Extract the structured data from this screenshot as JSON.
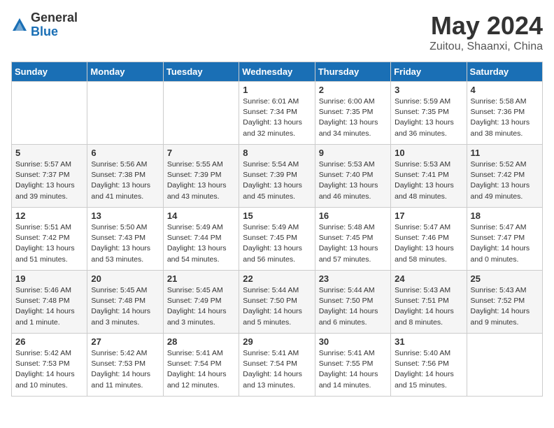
{
  "logo": {
    "general": "General",
    "blue": "Blue"
  },
  "title": "May 2024",
  "subtitle": "Zuitou, Shaanxi, China",
  "days_of_week": [
    "Sunday",
    "Monday",
    "Tuesday",
    "Wednesday",
    "Thursday",
    "Friday",
    "Saturday"
  ],
  "weeks": [
    [
      {
        "day": "",
        "info": ""
      },
      {
        "day": "",
        "info": ""
      },
      {
        "day": "",
        "info": ""
      },
      {
        "day": "1",
        "info": "Sunrise: 6:01 AM\nSunset: 7:34 PM\nDaylight: 13 hours\nand 32 minutes."
      },
      {
        "day": "2",
        "info": "Sunrise: 6:00 AM\nSunset: 7:35 PM\nDaylight: 13 hours\nand 34 minutes."
      },
      {
        "day": "3",
        "info": "Sunrise: 5:59 AM\nSunset: 7:35 PM\nDaylight: 13 hours\nand 36 minutes."
      },
      {
        "day": "4",
        "info": "Sunrise: 5:58 AM\nSunset: 7:36 PM\nDaylight: 13 hours\nand 38 minutes."
      }
    ],
    [
      {
        "day": "5",
        "info": "Sunrise: 5:57 AM\nSunset: 7:37 PM\nDaylight: 13 hours\nand 39 minutes."
      },
      {
        "day": "6",
        "info": "Sunrise: 5:56 AM\nSunset: 7:38 PM\nDaylight: 13 hours\nand 41 minutes."
      },
      {
        "day": "7",
        "info": "Sunrise: 5:55 AM\nSunset: 7:39 PM\nDaylight: 13 hours\nand 43 minutes."
      },
      {
        "day": "8",
        "info": "Sunrise: 5:54 AM\nSunset: 7:39 PM\nDaylight: 13 hours\nand 45 minutes."
      },
      {
        "day": "9",
        "info": "Sunrise: 5:53 AM\nSunset: 7:40 PM\nDaylight: 13 hours\nand 46 minutes."
      },
      {
        "day": "10",
        "info": "Sunrise: 5:53 AM\nSunset: 7:41 PM\nDaylight: 13 hours\nand 48 minutes."
      },
      {
        "day": "11",
        "info": "Sunrise: 5:52 AM\nSunset: 7:42 PM\nDaylight: 13 hours\nand 49 minutes."
      }
    ],
    [
      {
        "day": "12",
        "info": "Sunrise: 5:51 AM\nSunset: 7:42 PM\nDaylight: 13 hours\nand 51 minutes."
      },
      {
        "day": "13",
        "info": "Sunrise: 5:50 AM\nSunset: 7:43 PM\nDaylight: 13 hours\nand 53 minutes."
      },
      {
        "day": "14",
        "info": "Sunrise: 5:49 AM\nSunset: 7:44 PM\nDaylight: 13 hours\nand 54 minutes."
      },
      {
        "day": "15",
        "info": "Sunrise: 5:49 AM\nSunset: 7:45 PM\nDaylight: 13 hours\nand 56 minutes."
      },
      {
        "day": "16",
        "info": "Sunrise: 5:48 AM\nSunset: 7:45 PM\nDaylight: 13 hours\nand 57 minutes."
      },
      {
        "day": "17",
        "info": "Sunrise: 5:47 AM\nSunset: 7:46 PM\nDaylight: 13 hours\nand 58 minutes."
      },
      {
        "day": "18",
        "info": "Sunrise: 5:47 AM\nSunset: 7:47 PM\nDaylight: 14 hours\nand 0 minutes."
      }
    ],
    [
      {
        "day": "19",
        "info": "Sunrise: 5:46 AM\nSunset: 7:48 PM\nDaylight: 14 hours\nand 1 minute."
      },
      {
        "day": "20",
        "info": "Sunrise: 5:45 AM\nSunset: 7:48 PM\nDaylight: 14 hours\nand 3 minutes."
      },
      {
        "day": "21",
        "info": "Sunrise: 5:45 AM\nSunset: 7:49 PM\nDaylight: 14 hours\nand 3 minutes."
      },
      {
        "day": "22",
        "info": "Sunrise: 5:44 AM\nSunset: 7:50 PM\nDaylight: 14 hours\nand 5 minutes."
      },
      {
        "day": "23",
        "info": "Sunrise: 5:44 AM\nSunset: 7:50 PM\nDaylight: 14 hours\nand 6 minutes."
      },
      {
        "day": "24",
        "info": "Sunrise: 5:43 AM\nSunset: 7:51 PM\nDaylight: 14 hours\nand 8 minutes."
      },
      {
        "day": "25",
        "info": "Sunrise: 5:43 AM\nSunset: 7:52 PM\nDaylight: 14 hours\nand 9 minutes."
      }
    ],
    [
      {
        "day": "26",
        "info": "Sunrise: 5:42 AM\nSunset: 7:53 PM\nDaylight: 14 hours\nand 10 minutes."
      },
      {
        "day": "27",
        "info": "Sunrise: 5:42 AM\nSunset: 7:53 PM\nDaylight: 14 hours\nand 11 minutes."
      },
      {
        "day": "28",
        "info": "Sunrise: 5:41 AM\nSunset: 7:54 PM\nDaylight: 14 hours\nand 12 minutes."
      },
      {
        "day": "29",
        "info": "Sunrise: 5:41 AM\nSunset: 7:54 PM\nDaylight: 14 hours\nand 13 minutes."
      },
      {
        "day": "30",
        "info": "Sunrise: 5:41 AM\nSunset: 7:55 PM\nDaylight: 14 hours\nand 14 minutes."
      },
      {
        "day": "31",
        "info": "Sunrise: 5:40 AM\nSunset: 7:56 PM\nDaylight: 14 hours\nand 15 minutes."
      },
      {
        "day": "",
        "info": ""
      }
    ]
  ]
}
